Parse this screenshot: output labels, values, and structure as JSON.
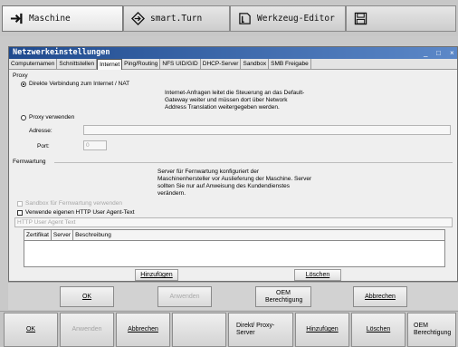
{
  "mode_tabs": [
    {
      "label": "Maschine",
      "icon": "machine-arrow-icon"
    },
    {
      "label": "smart.Turn",
      "icon": "smart-turn-diamond-icon"
    },
    {
      "label": "Werkzeug-Editor",
      "icon": "tool-editor-icon"
    },
    {
      "label": "",
      "icon": "save-disk-icon"
    }
  ],
  "window": {
    "title": "Netzwerkeinstellungen",
    "controls": [
      "_",
      "□",
      "×"
    ],
    "tabs": [
      "Computernamen",
      "Schnittstellen",
      "Internet",
      "Ping/Routing",
      "NFS UID/GID",
      "DHCP-Server",
      "Sandbox",
      "SMB Freigabe"
    ],
    "active_tab": "Internet"
  },
  "proxy": {
    "section_label": "Proxy",
    "direct_label": "Direkte Verbindung zum Internet / NAT",
    "direct_desc": [
      "Internet-Anfragen leitet die Steuerung an das Default-",
      "Gateway weiter und müssen dort über Network",
      "Address Translation weitergegeben werden."
    ],
    "use_proxy_label": "Proxy verwenden",
    "address_label": "Adresse:",
    "address_value": "",
    "port_label": "Port:",
    "port_value": "0"
  },
  "remote": {
    "section_label": "Fernwartung",
    "desc": [
      "Server für Fernwartung konfiguriert der",
      "Maschinenhersteller vor Auslieferung der Maschine. Server",
      "sollten Sie nur auf Anweisung des Kundendienstes",
      "verändern."
    ],
    "sandbox_label": "Sandbox für Fernwartung verwenden",
    "user_agent_label": "Verwende eigenen HTTP User Agent-Text",
    "user_agent_placeholder": "HTTP User Agent Text",
    "columns": [
      "Zertifikat",
      "Server",
      "Beschreibung"
    ],
    "add_label": "Hinzufügen",
    "delete_label": "Löschen"
  },
  "dialog_buttons": [
    {
      "label": "OK",
      "enabled": true
    },
    {
      "label": "Anwenden",
      "enabled": false
    },
    {
      "label": "OEM Berechtigung",
      "enabled": true
    },
    {
      "label": "Abbrechen",
      "enabled": true
    }
  ],
  "softkeys": [
    {
      "label": "OK",
      "enabled": true
    },
    {
      "label": "Anwenden",
      "enabled": false
    },
    {
      "label": "Abbrechen",
      "enabled": true
    },
    {
      "label": "",
      "enabled": false
    },
    {
      "label": "Direkt/ Proxy-Server",
      "enabled": true
    },
    {
      "label": "Hinzufügen",
      "enabled": true
    },
    {
      "label": "Löschen",
      "enabled": true
    },
    {
      "label": "OEM Berechtigung",
      "enabled": true
    }
  ]
}
